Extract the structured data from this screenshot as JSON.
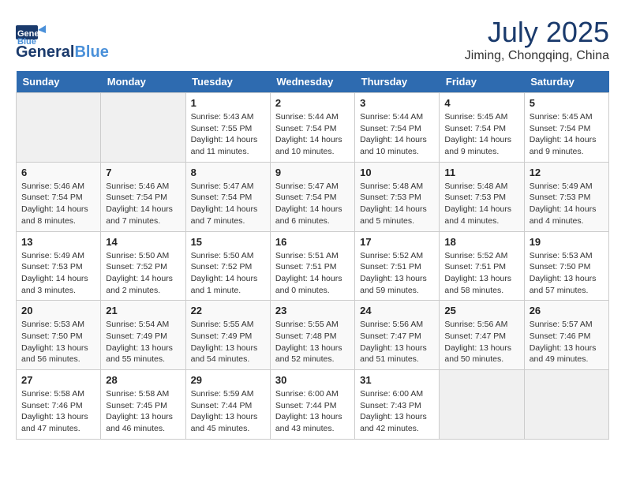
{
  "logo": {
    "line1": "General",
    "line2": "Blue"
  },
  "title": "July 2025",
  "location": "Jiming, Chongqing, China",
  "days_of_week": [
    "Sunday",
    "Monday",
    "Tuesday",
    "Wednesday",
    "Thursday",
    "Friday",
    "Saturday"
  ],
  "weeks": [
    [
      {
        "day": "",
        "info": ""
      },
      {
        "day": "",
        "info": ""
      },
      {
        "day": "1",
        "info": "Sunrise: 5:43 AM\nSunset: 7:55 PM\nDaylight: 14 hours and 11 minutes."
      },
      {
        "day": "2",
        "info": "Sunrise: 5:44 AM\nSunset: 7:54 PM\nDaylight: 14 hours and 10 minutes."
      },
      {
        "day": "3",
        "info": "Sunrise: 5:44 AM\nSunset: 7:54 PM\nDaylight: 14 hours and 10 minutes."
      },
      {
        "day": "4",
        "info": "Sunrise: 5:45 AM\nSunset: 7:54 PM\nDaylight: 14 hours and 9 minutes."
      },
      {
        "day": "5",
        "info": "Sunrise: 5:45 AM\nSunset: 7:54 PM\nDaylight: 14 hours and 9 minutes."
      }
    ],
    [
      {
        "day": "6",
        "info": "Sunrise: 5:46 AM\nSunset: 7:54 PM\nDaylight: 14 hours and 8 minutes."
      },
      {
        "day": "7",
        "info": "Sunrise: 5:46 AM\nSunset: 7:54 PM\nDaylight: 14 hours and 7 minutes."
      },
      {
        "day": "8",
        "info": "Sunrise: 5:47 AM\nSunset: 7:54 PM\nDaylight: 14 hours and 7 minutes."
      },
      {
        "day": "9",
        "info": "Sunrise: 5:47 AM\nSunset: 7:54 PM\nDaylight: 14 hours and 6 minutes."
      },
      {
        "day": "10",
        "info": "Sunrise: 5:48 AM\nSunset: 7:53 PM\nDaylight: 14 hours and 5 minutes."
      },
      {
        "day": "11",
        "info": "Sunrise: 5:48 AM\nSunset: 7:53 PM\nDaylight: 14 hours and 4 minutes."
      },
      {
        "day": "12",
        "info": "Sunrise: 5:49 AM\nSunset: 7:53 PM\nDaylight: 14 hours and 4 minutes."
      }
    ],
    [
      {
        "day": "13",
        "info": "Sunrise: 5:49 AM\nSunset: 7:53 PM\nDaylight: 14 hours and 3 minutes."
      },
      {
        "day": "14",
        "info": "Sunrise: 5:50 AM\nSunset: 7:52 PM\nDaylight: 14 hours and 2 minutes."
      },
      {
        "day": "15",
        "info": "Sunrise: 5:50 AM\nSunset: 7:52 PM\nDaylight: 14 hours and 1 minute."
      },
      {
        "day": "16",
        "info": "Sunrise: 5:51 AM\nSunset: 7:51 PM\nDaylight: 14 hours and 0 minutes."
      },
      {
        "day": "17",
        "info": "Sunrise: 5:52 AM\nSunset: 7:51 PM\nDaylight: 13 hours and 59 minutes."
      },
      {
        "day": "18",
        "info": "Sunrise: 5:52 AM\nSunset: 7:51 PM\nDaylight: 13 hours and 58 minutes."
      },
      {
        "day": "19",
        "info": "Sunrise: 5:53 AM\nSunset: 7:50 PM\nDaylight: 13 hours and 57 minutes."
      }
    ],
    [
      {
        "day": "20",
        "info": "Sunrise: 5:53 AM\nSunset: 7:50 PM\nDaylight: 13 hours and 56 minutes."
      },
      {
        "day": "21",
        "info": "Sunrise: 5:54 AM\nSunset: 7:49 PM\nDaylight: 13 hours and 55 minutes."
      },
      {
        "day": "22",
        "info": "Sunrise: 5:55 AM\nSunset: 7:49 PM\nDaylight: 13 hours and 54 minutes."
      },
      {
        "day": "23",
        "info": "Sunrise: 5:55 AM\nSunset: 7:48 PM\nDaylight: 13 hours and 52 minutes."
      },
      {
        "day": "24",
        "info": "Sunrise: 5:56 AM\nSunset: 7:47 PM\nDaylight: 13 hours and 51 minutes."
      },
      {
        "day": "25",
        "info": "Sunrise: 5:56 AM\nSunset: 7:47 PM\nDaylight: 13 hours and 50 minutes."
      },
      {
        "day": "26",
        "info": "Sunrise: 5:57 AM\nSunset: 7:46 PM\nDaylight: 13 hours and 49 minutes."
      }
    ],
    [
      {
        "day": "27",
        "info": "Sunrise: 5:58 AM\nSunset: 7:46 PM\nDaylight: 13 hours and 47 minutes."
      },
      {
        "day": "28",
        "info": "Sunrise: 5:58 AM\nSunset: 7:45 PM\nDaylight: 13 hours and 46 minutes."
      },
      {
        "day": "29",
        "info": "Sunrise: 5:59 AM\nSunset: 7:44 PM\nDaylight: 13 hours and 45 minutes."
      },
      {
        "day": "30",
        "info": "Sunrise: 6:00 AM\nSunset: 7:44 PM\nDaylight: 13 hours and 43 minutes."
      },
      {
        "day": "31",
        "info": "Sunrise: 6:00 AM\nSunset: 7:43 PM\nDaylight: 13 hours and 42 minutes."
      },
      {
        "day": "",
        "info": ""
      },
      {
        "day": "",
        "info": ""
      }
    ]
  ]
}
